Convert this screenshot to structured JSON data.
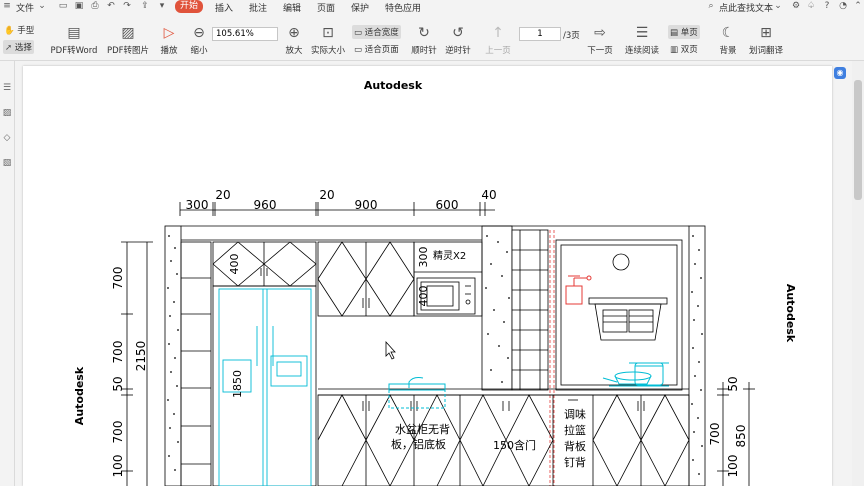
{
  "menubar": {
    "file_label": "文件",
    "tabs": [
      "开始",
      "插入",
      "批注",
      "编辑",
      "页面",
      "保护",
      "特色应用"
    ],
    "search_label": "点此查找文本"
  },
  "ribbon": {
    "hand_label": "手型",
    "select_label": "选择",
    "pdf_word_label": "PDF转Word",
    "pdf_image_label": "PDF转图片",
    "play_label": "播放",
    "zoom_out_label": "缩小",
    "zoom_value": "105.61%",
    "zoom_in_label": "放大",
    "actual_size_label": "实际大小",
    "fit_width_label": "适合宽度",
    "fit_page_label": "适合页面",
    "rotate_cw_label": "顺时针",
    "rotate_ccw_label": "逆时针",
    "prev_page_label": "上一页",
    "page_current": "1",
    "page_total": "/3页",
    "next_page_label": "下一页",
    "continuous_label": "连续阅读",
    "single_label": "单页",
    "double_label": "双页",
    "background_label": "背景",
    "translate_label": "划词翻译"
  },
  "drawing": {
    "title_top": "Autodesk",
    "title_left": "Autodesk",
    "title_right": "Autodesk",
    "dims_top": [
      "300",
      "20",
      "960",
      "20",
      "900",
      "600",
      "40"
    ],
    "dims_left": [
      "700",
      "2150",
      "700",
      "50",
      "700",
      "100"
    ],
    "dims_right": [
      "50",
      "700",
      "850",
      "100"
    ],
    "dims_inner": [
      "400",
      "300",
      "1850",
      "400"
    ],
    "label_microwave": "精灵X2",
    "label_sink": "水盆柜无背板，铝底板",
    "label_sink_line1": "水盆柜无背",
    "label_sink_line2": "板，铝底板",
    "label_cabinet": "150含门",
    "label_spice1": "调味",
    "label_spice2": "拉篮",
    "label_spice3": "背板",
    "label_spice4": "钉背"
  },
  "colors": {
    "accent": "#e0533b",
    "cyan": "#00bcd4",
    "red_line": "#e53935"
  }
}
